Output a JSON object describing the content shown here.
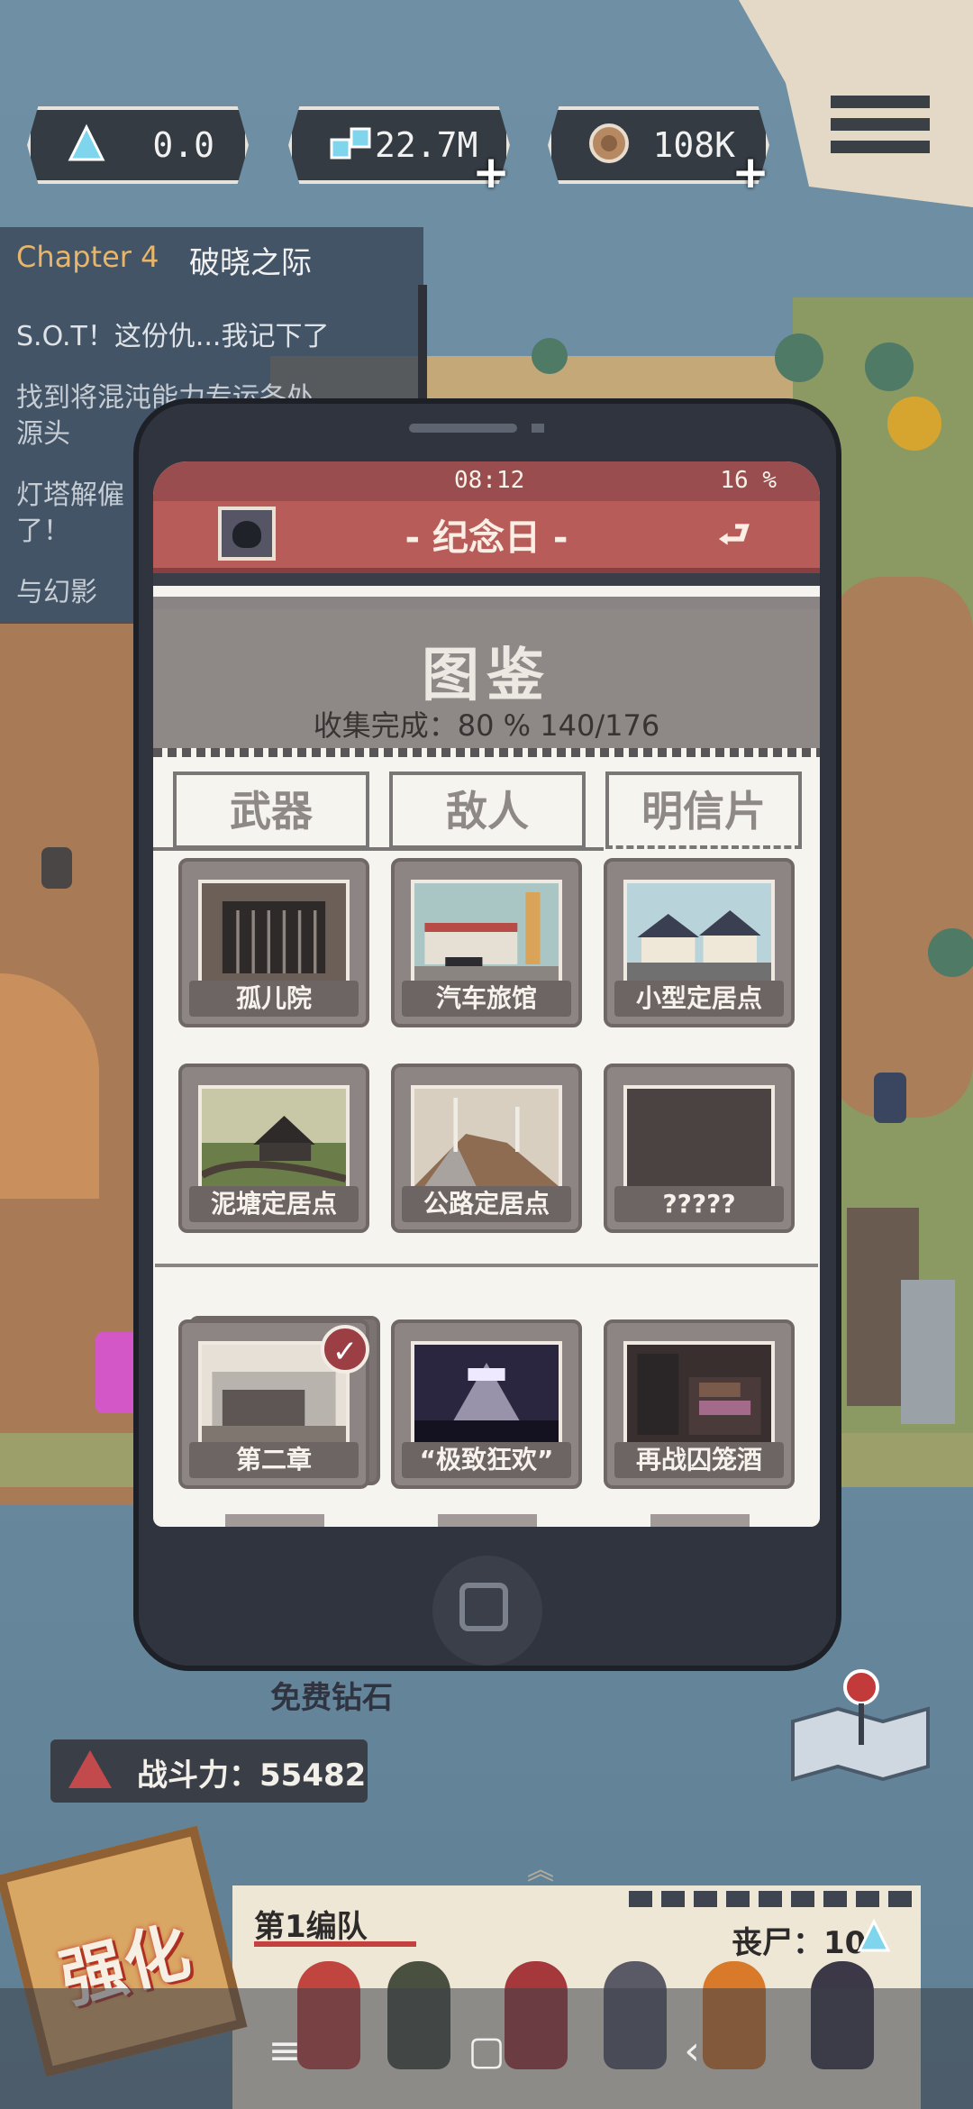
{
  "resources": [
    {
      "name": "crystal",
      "value": "0.0",
      "icon": "triangle-crystal-icon",
      "has_plus": false
    },
    {
      "name": "chips",
      "value": "22.7M",
      "icon": "chips-icon",
      "has_plus": true
    },
    {
      "name": "coins",
      "value": "108K",
      "icon": "coin-icon",
      "has_plus": true
    }
  ],
  "quest": {
    "chapter_label": "Chapter 4",
    "chapter_name": "破晓之际",
    "lines": [
      "S.O.T！这份仇...我记下了",
      "找到将混沌能力专运各处",
      "源头",
      "灯塔解僱",
      "了！",
      "与幻影"
    ]
  },
  "phone": {
    "time": "08:12",
    "battery": "16 %",
    "title": "- 纪念日 -",
    "header": "图鉴",
    "progress_text": "收集完成：80 %  140/176",
    "tabs": [
      {
        "label": "武器",
        "active": false
      },
      {
        "label": "敌人",
        "active": false
      },
      {
        "label": "明信片",
        "active": true
      }
    ],
    "cards": [
      {
        "label": "孤儿院",
        "checked": false
      },
      {
        "label": "汽车旅馆",
        "checked": false
      },
      {
        "label": "小型定居点",
        "checked": false
      },
      {
        "label": "泥塘定居点",
        "checked": false
      },
      {
        "label": "公路定居点",
        "checked": false
      },
      {
        "label": "?????",
        "checked": false
      },
      {
        "label": "第二章",
        "checked": true
      },
      {
        "label": "“极致狂欢”",
        "checked": false
      },
      {
        "label": "再战囚笼酒",
        "checked": false
      }
    ]
  },
  "bottom": {
    "free_diamond": "免费钻石",
    "power": "战斗力：55482",
    "team_name": "第1编队",
    "zombie_label": "丧尸：10",
    "upgrade_label": "强化"
  },
  "colors": {
    "accent_red": "#b85c5a",
    "panel_gray": "#8e8886",
    "phone_body": "#30343e"
  }
}
